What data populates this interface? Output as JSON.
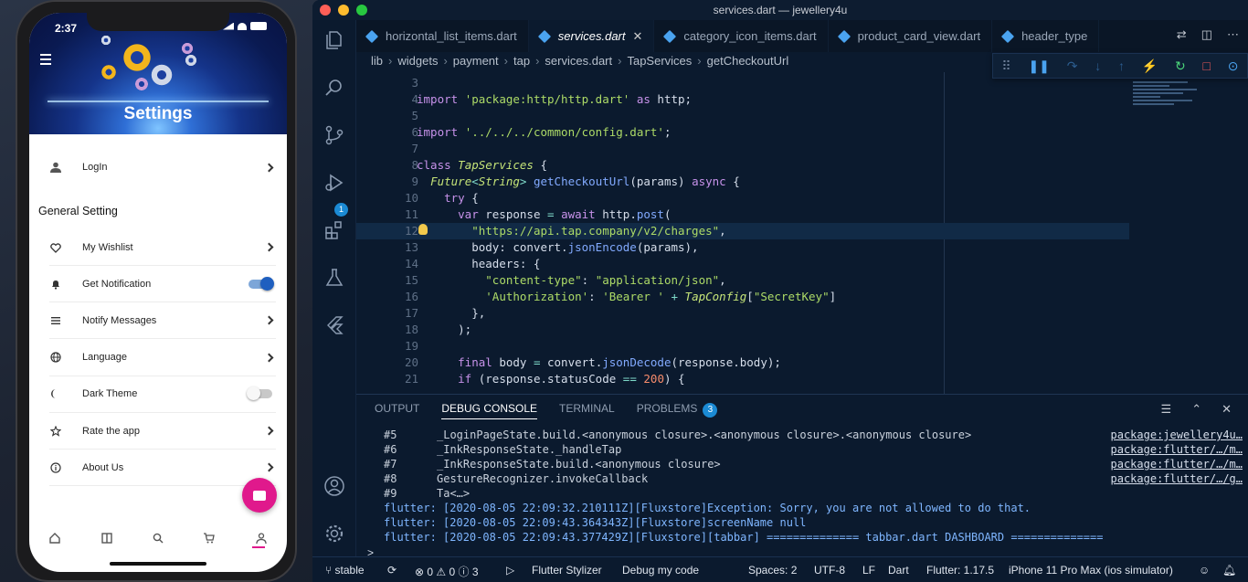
{
  "phone": {
    "status_time": "2:37",
    "header_title": "Settings",
    "login_label": "LogIn",
    "section_title": "General Setting",
    "items": [
      {
        "label": "My Wishlist",
        "icon": "heart-icon",
        "control": "chevron"
      },
      {
        "label": "Get Notification",
        "icon": "bell-icon",
        "control": "toggle",
        "on": true
      },
      {
        "label": "Notify Messages",
        "icon": "list-icon",
        "control": "chevron"
      },
      {
        "label": "Language",
        "icon": "globe-icon",
        "control": "chevron"
      },
      {
        "label": "Dark Theme",
        "icon": "moon-icon",
        "control": "toggle",
        "on": false
      },
      {
        "label": "Rate the app",
        "icon": "star-icon",
        "control": "chevron"
      },
      {
        "label": "About Us",
        "icon": "info-icon",
        "control": "chevron"
      }
    ],
    "tabs": [
      "home-icon",
      "category-icon",
      "search-icon",
      "cart-icon",
      "profile-icon"
    ],
    "accent": "#e0198c"
  },
  "window": {
    "title": "services.dart — jewellery4u"
  },
  "editor_tabs": [
    {
      "label": "horizontal_list_items.dart",
      "active": false
    },
    {
      "label": "services.dart",
      "active": true
    },
    {
      "label": "category_icon_items.dart",
      "active": false
    },
    {
      "label": "product_card_view.dart",
      "active": false
    },
    {
      "label": "header_type",
      "active": false
    }
  ],
  "breadcrumb": [
    "lib",
    "widgets",
    "payment",
    "tap",
    "services.dart",
    "TapServices",
    "getCheckoutUrl"
  ],
  "code_lines": [
    {
      "n": "3",
      "html": ""
    },
    {
      "n": "4",
      "html": "<span class='k-kw'>import</span> <span class='k-str'>'package:http/http.dart'</span> <span class='k-kw'>as</span> http;"
    },
    {
      "n": "5",
      "html": ""
    },
    {
      "n": "6",
      "html": "<span class='k-kw'>import</span> <span class='k-str'>'../../../common/config.dart'</span>;"
    },
    {
      "n": "7",
      "html": ""
    },
    {
      "n": "8",
      "html": "<span class='k-kw'>class</span> <span class='k-ty'>TapServices</span> {"
    },
    {
      "n": "9",
      "html": "  <span class='k-ty'>Future</span><span class='k-punc'>&lt;</span><span class='k-ty'>String</span><span class='k-punc'>&gt;</span> <span class='k-fn'>getCheckoutUrl</span>(params) <span class='k-kw'>async</span> {"
    },
    {
      "n": "10",
      "html": "    <span class='k-kw'>try</span> {"
    },
    {
      "n": "11",
      "html": "      <span class='k-kw'>var</span> response <span class='k-punc'>=</span> <span class='k-kw'>await</span> http.<span class='k-fn'>post</span>("
    },
    {
      "n": "12",
      "html": "        <span class='k-str'>\"https://api.tap.company/v2/charges\"</span>,"
    },
    {
      "n": "13",
      "html": "        body: convert.<span class='k-fn'>jsonEncode</span>(params),"
    },
    {
      "n": "14",
      "html": "        headers: {"
    },
    {
      "n": "15",
      "html": "          <span class='k-str'>\"content-type\"</span>: <span class='k-str'>\"application/json\"</span>,"
    },
    {
      "n": "16",
      "html": "          <span class='k-str'>'Authorization'</span>: <span class='k-str'>'Bearer '</span> <span class='k-punc'>+</span> <span class='k-ty'>TapConfig</span>[<span class='k-str'>\"SecretKey\"</span>]"
    },
    {
      "n": "17",
      "html": "        },"
    },
    {
      "n": "18",
      "html": "      );"
    },
    {
      "n": "19",
      "html": ""
    },
    {
      "n": "20",
      "html": "      <span class='k-kw'>final</span> body <span class='k-punc'>=</span> convert.<span class='k-fn'>jsonDecode</span>(response.body);"
    },
    {
      "n": "21",
      "html": "      <span class='k-kw'>if</span> (response.statusCode <span class='k-punc'>==</span> <span class='k-num'>200</span>) {"
    }
  ],
  "panel": {
    "tabs": [
      "OUTPUT",
      "DEBUG CONSOLE",
      "TERMINAL",
      "PROBLEMS"
    ],
    "active_tab": "DEBUG CONSOLE",
    "problems_count": "3",
    "lines": [
      {
        "n": "#5",
        "text": "_LoginPageState.build.<anonymous closure>.<anonymous closure>.<anonymous closure>",
        "link": "package:jewellery4u…"
      },
      {
        "n": "#6",
        "text": "_InkResponseState._handleTap",
        "link": "package:flutter/…/m…"
      },
      {
        "n": "#7",
        "text": "_InkResponseState.build.<anonymous closure>",
        "link": "package:flutter/…/m…"
      },
      {
        "n": "#8",
        "text": "GestureRecognizer.invokeCallback",
        "link": "package:flutter/…/g…"
      },
      {
        "n": "#9",
        "text": "Ta<…>",
        "link": ""
      },
      {
        "n": "",
        "text": "flutter: [2020-08-05 22:09:32.210111Z][Fluxstore]Exception: Sorry, you are not allowed to do that.",
        "link": ""
      },
      {
        "n": "",
        "text": "flutter: [2020-08-05 22:09:43.364343Z][Fluxstore]screenName null",
        "link": ""
      },
      {
        "n": "",
        "text": "flutter: [2020-08-05 22:09:43.377429Z][Fluxstore][tabbar] ============== tabbar.dart DASHBOARD ==============",
        "link": ""
      }
    ],
    "prompt": ">"
  },
  "statusbar": {
    "branch": "stable",
    "errors": "0",
    "warnings": "0",
    "infos": "3",
    "stylizer": "Flutter Stylizer",
    "debug": "Debug my code",
    "spaces": "Spaces: 2",
    "encoding": "UTF-8",
    "eol": "LF",
    "language": "Dart",
    "flutter_version": "Flutter: 1.17.5",
    "device": "iPhone 11 Pro Max (ios simulator)"
  },
  "activity_badge": "1"
}
